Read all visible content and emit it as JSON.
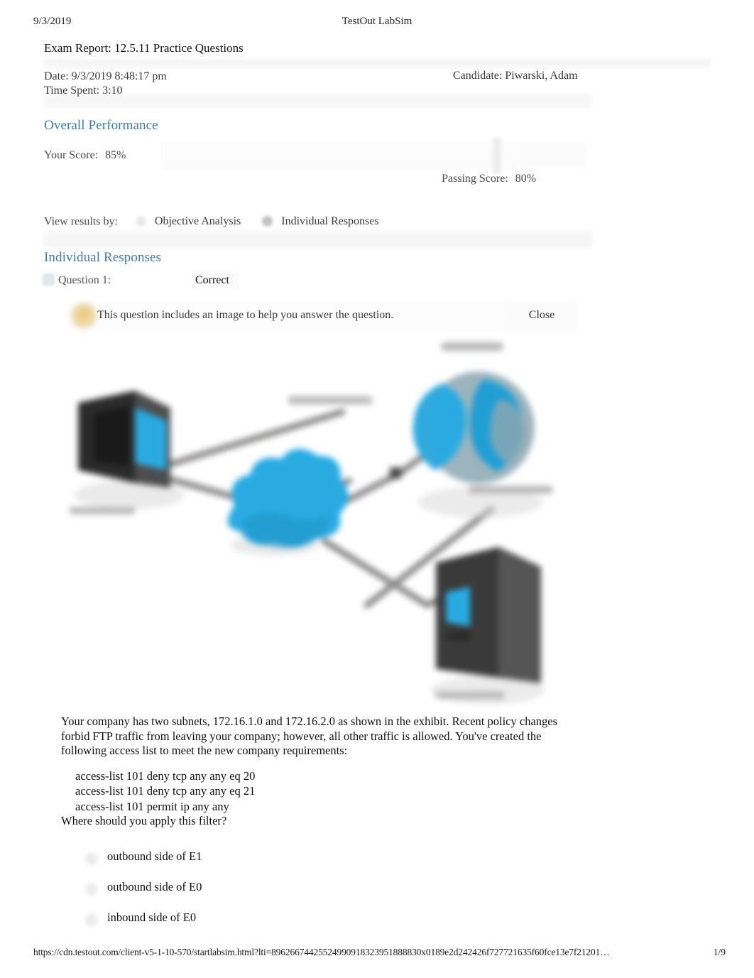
{
  "print": {
    "date": "9/3/2019",
    "app_title": "TestOut LabSim",
    "footer_url": "https://cdn.testout.com/client-v5-1-10-570/startlabsim.html?lti=89626674425524990918323951888830x0189e2d242426f727721635f60fce13e7f21201…",
    "page_number": "1/9"
  },
  "report": {
    "title": "Exam Report: 12.5.11 Practice Questions",
    "date_line": "Date: 9/3/2019 8:48:17 pm",
    "time_spent_line": "Time Spent: 3:10",
    "candidate_line": "Candidate: Piwarski, Adam"
  },
  "overall": {
    "heading": "Overall Performance",
    "your_score_label": "Your Score:",
    "your_score_value": "85%",
    "passing_score_label": "Passing Score:",
    "passing_score_value": "80%",
    "score_percent": 85,
    "passing_percent": 80
  },
  "view_results": {
    "label": "View results by:",
    "options": [
      {
        "label": "Objective Analysis",
        "selected": false
      },
      {
        "label": "Individual Responses",
        "selected": true
      }
    ]
  },
  "individual": {
    "heading": "Individual Responses",
    "question_label": "Question 1:",
    "question_result": "Correct"
  },
  "notice": {
    "text": "This question includes an image to help you answer the question.",
    "close_label": "Close"
  },
  "exhibit": {
    "description": "Network diagram exhibit showing a workstation, router, internet globe and server connected by links (labels blurred)"
  },
  "question": {
    "paragraph": "Your company has two subnets, 172.16.1.0 and 172.16.2.0 as shown in the exhibit. Recent policy changes forbid FTP traffic from leaving your company; however, all other traffic is allowed. You've created the following access list to meet the new company requirements:",
    "access_list": [
      "access-list 101 deny tcp any any eq 20",
      "access-list 101 deny tcp any any eq 21",
      "access-list 101 permit ip any any"
    ],
    "prompt": "Where should you apply this filter?",
    "options": [
      "outbound side of E1",
      "outbound side of E0",
      "inbound side of E0"
    ]
  },
  "colors": {
    "heading_blue": "#3b7ea8",
    "body_text": "#111111",
    "muted_text": "#4a4a4a",
    "diagram_node": "#29abe2",
    "diagram_link": "#888888"
  }
}
